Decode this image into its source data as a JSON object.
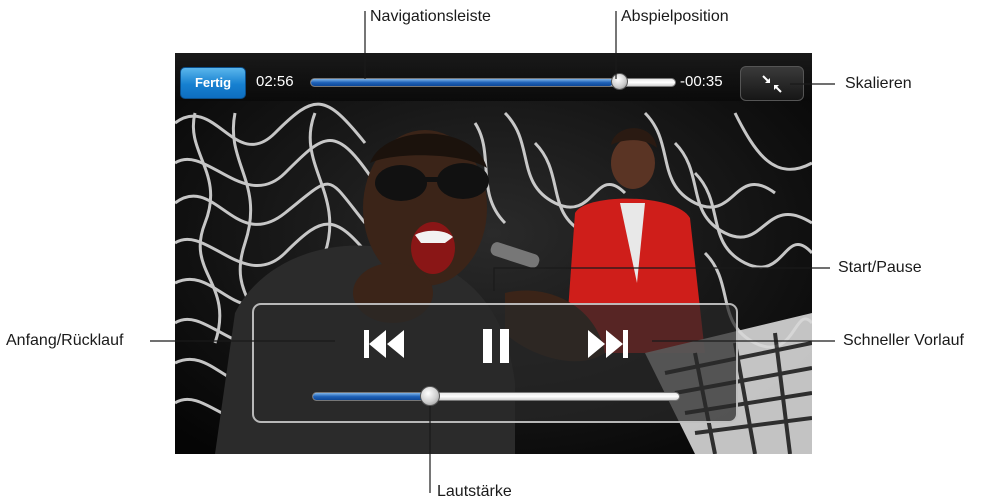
{
  "player": {
    "done_label": "Fertig",
    "time_elapsed": "02:56",
    "time_remaining": "-00:35",
    "scrubber_progress": 0.83,
    "volume_level": 0.33
  },
  "callouts": {
    "navigation_bar": "Navigationsleiste",
    "playhead": "Abspielposition",
    "scale": "Skalieren",
    "play_pause": "Start/Pause",
    "previous": "Anfang/Rücklauf",
    "fast_forward": "Schneller Vorlauf",
    "volume": "Lautstärke"
  },
  "colors": {
    "accent_blue": "#1680d0",
    "progress_blue": "#1f62b8",
    "bar_background": "#0a0a0a"
  },
  "icons": {
    "scale": "shrink-arrows-icon",
    "previous": "skip-back-icon",
    "play_pause": "pause-icon",
    "next": "skip-forward-icon"
  }
}
